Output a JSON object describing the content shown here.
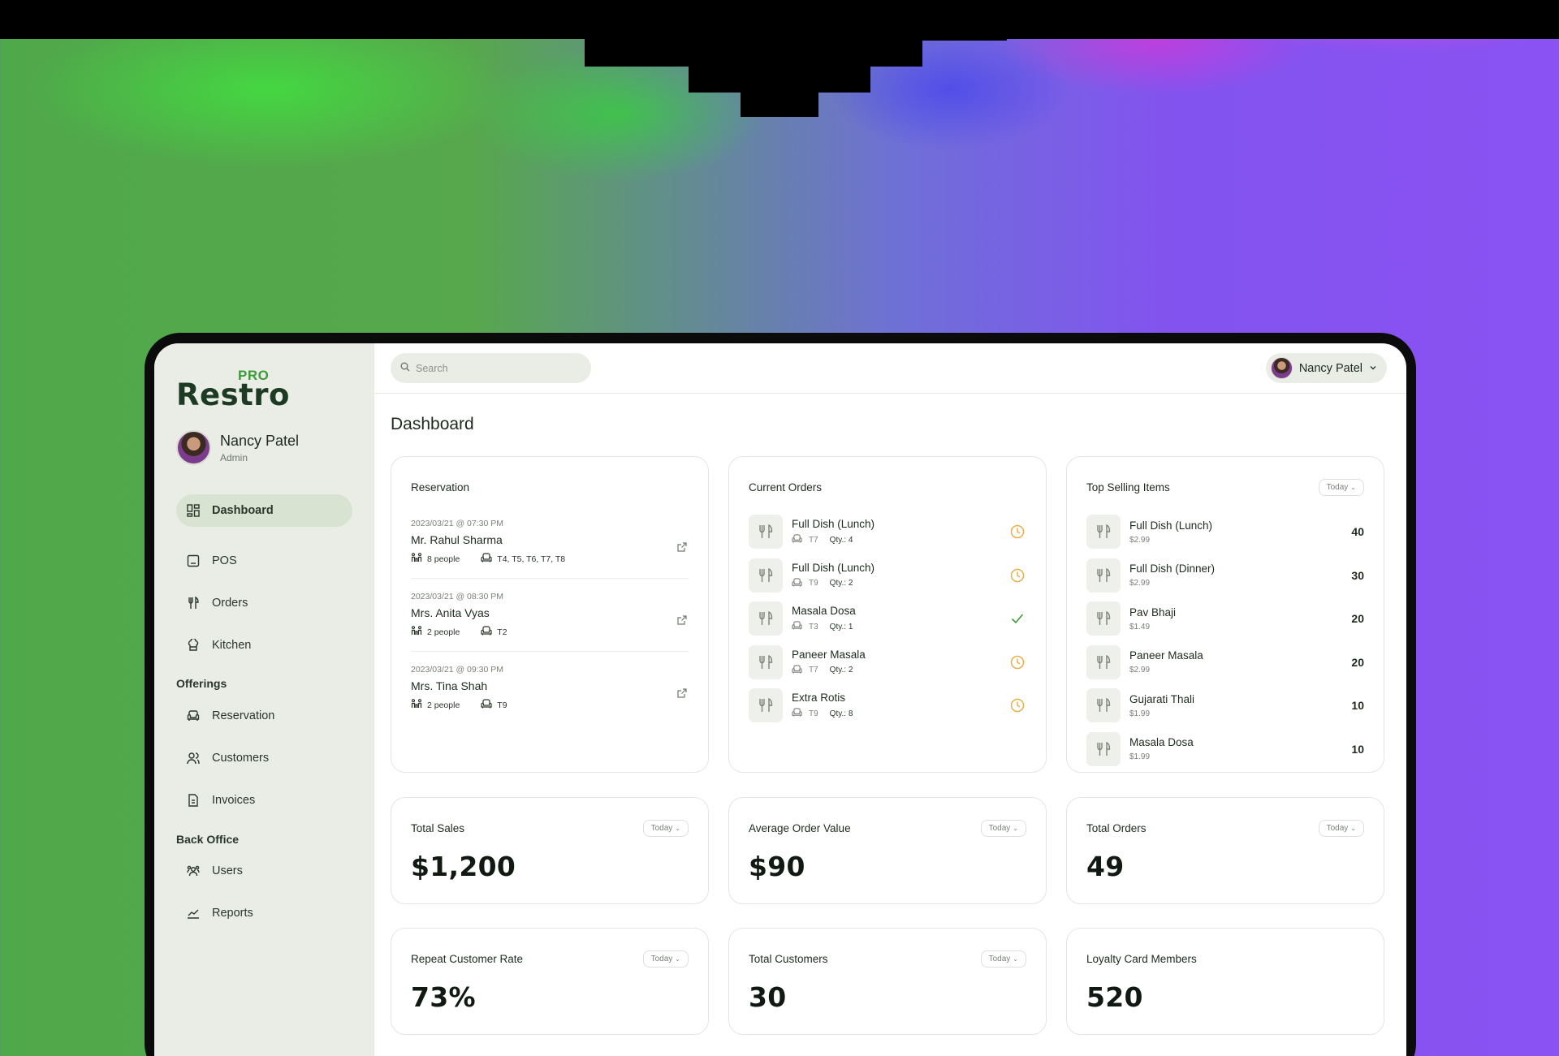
{
  "app": {
    "logo_main": "Restro",
    "logo_badge": "PRO"
  },
  "profile": {
    "name": "Nancy Patel",
    "role": "Admin"
  },
  "sidebar": {
    "items": [
      {
        "label": "Dashboard",
        "icon": "dashboard-icon",
        "active": true
      },
      {
        "label": "POS",
        "icon": "pos-icon"
      },
      {
        "label": "Orders",
        "icon": "cutlery-icon"
      },
      {
        "label": "Kitchen",
        "icon": "chef-hat-icon"
      }
    ],
    "offerings_label": "Offerings",
    "offerings": [
      {
        "label": "Reservation",
        "icon": "armchair-icon"
      },
      {
        "label": "Customers",
        "icon": "users-icon"
      },
      {
        "label": "Invoices",
        "icon": "invoice-icon"
      }
    ],
    "back_office_label": "Back Office",
    "back_office": [
      {
        "label": "Users",
        "icon": "team-icon"
      },
      {
        "label": "Reports",
        "icon": "chart-icon"
      }
    ]
  },
  "topbar": {
    "search_placeholder": "Search",
    "user_name": "Nancy Patel"
  },
  "page_title": "Dashboard",
  "reservation": {
    "title": "Reservation",
    "items": [
      {
        "timestamp": "2023/03/21 @ 07:30 PM",
        "name": "Mr. Rahul Sharma",
        "people": "8 people",
        "tables": "T4, T5, T6, T7, T8"
      },
      {
        "timestamp": "2023/03/21 @ 08:30 PM",
        "name": "Mrs. Anita Vyas",
        "people": "2 people",
        "tables": "T2"
      },
      {
        "timestamp": "2023/03/21 @ 09:30 PM",
        "name": "Mrs. Tina Shah",
        "people": "2 people",
        "tables": "T9"
      }
    ]
  },
  "current_orders": {
    "title": "Current Orders",
    "items": [
      {
        "name": "Full Dish (Lunch)",
        "table": "T7",
        "qty": "Qty.: 4",
        "status": "pending"
      },
      {
        "name": "Full Dish (Lunch)",
        "table": "T9",
        "qty": "Qty.: 2",
        "status": "pending"
      },
      {
        "name": "Masala Dosa",
        "table": "T3",
        "qty": "Qty.: 1",
        "status": "done"
      },
      {
        "name": "Paneer Masala",
        "table": "T7",
        "qty": "Qty.: 2",
        "status": "pending"
      },
      {
        "name": "Extra Rotis",
        "table": "T9",
        "qty": "Qty.: 8",
        "status": "pending"
      }
    ]
  },
  "top_selling": {
    "title": "Top Selling Items",
    "period": "Today",
    "items": [
      {
        "name": "Full Dish (Lunch)",
        "price": "$2.99",
        "count": "40"
      },
      {
        "name": "Full Dish (Dinner)",
        "price": "$2.99",
        "count": "30"
      },
      {
        "name": "Pav Bhaji",
        "price": "$1.49",
        "count": "20"
      },
      {
        "name": "Paneer Masala",
        "price": "$2.99",
        "count": "20"
      },
      {
        "name": "Gujarati Thali",
        "price": "$1.99",
        "count": "10"
      },
      {
        "name": "Masala Dosa",
        "price": "$1.99",
        "count": "10"
      }
    ]
  },
  "stats": {
    "total_sales": {
      "label": "Total Sales",
      "value": "$1,200",
      "period": "Today"
    },
    "avg_order": {
      "label": "Average Order Value",
      "value": "$90",
      "period": "Today"
    },
    "total_orders": {
      "label": "Total Orders",
      "value": "49",
      "period": "Today"
    },
    "repeat_rate": {
      "label": "Repeat Customer Rate",
      "value": "73%",
      "period": "Today"
    },
    "total_customers": {
      "label": "Total Customers",
      "value": "30",
      "period": "Today"
    },
    "loyalty": {
      "label": "Loyalty Card Members",
      "value": "520"
    }
  },
  "colors": {
    "accent_green": "#3f9a3a",
    "sidebar_bg": "#eaede6",
    "pending": "#e9b04a",
    "done": "#3f9a3a"
  }
}
